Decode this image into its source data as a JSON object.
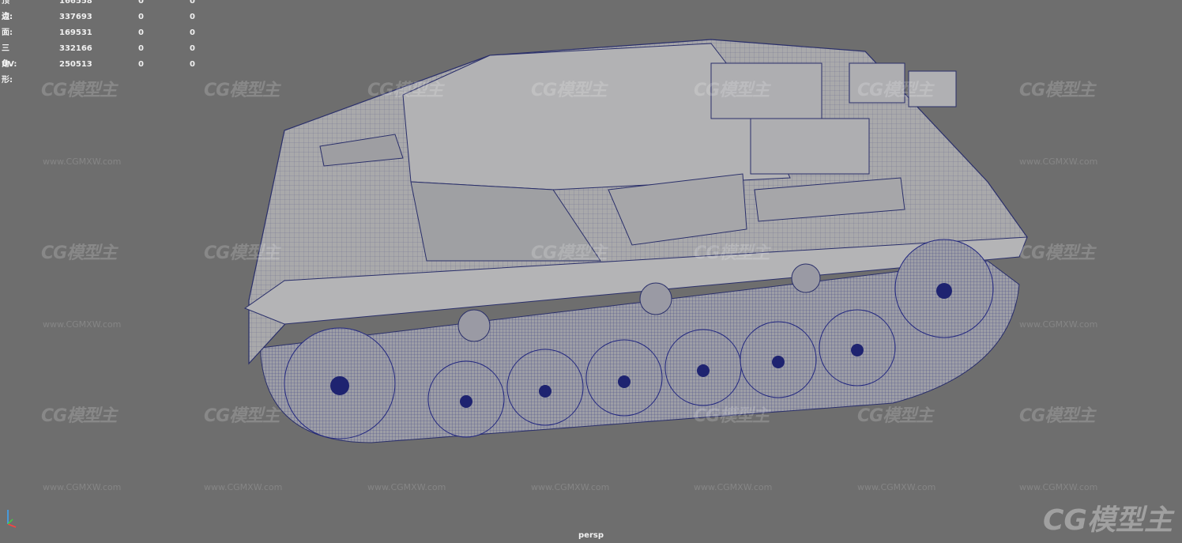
{
  "hud": {
    "rows": [
      {
        "label": "顶点:",
        "v1": "166558",
        "v2": "0",
        "v3": "0"
      },
      {
        "label": "边:",
        "v1": "337693",
        "v2": "0",
        "v3": "0"
      },
      {
        "label": "面:",
        "v1": "169531",
        "v2": "0",
        "v3": "0"
      },
      {
        "label": "三角形:",
        "v1": "332166",
        "v2": "0",
        "v3": "0"
      },
      {
        "label": "UV:",
        "v1": "250513",
        "v2": "0",
        "v3": "0"
      }
    ]
  },
  "watermark": {
    "brand": "CG模型主",
    "url": "www.CGMXW.com"
  },
  "camera": {
    "label": "persp"
  },
  "colors": {
    "background": "#6e6e6e",
    "mesh_fill": "#a8a8a8",
    "wire": "#2a2f6a",
    "hud_text": "#f0f0f0"
  }
}
